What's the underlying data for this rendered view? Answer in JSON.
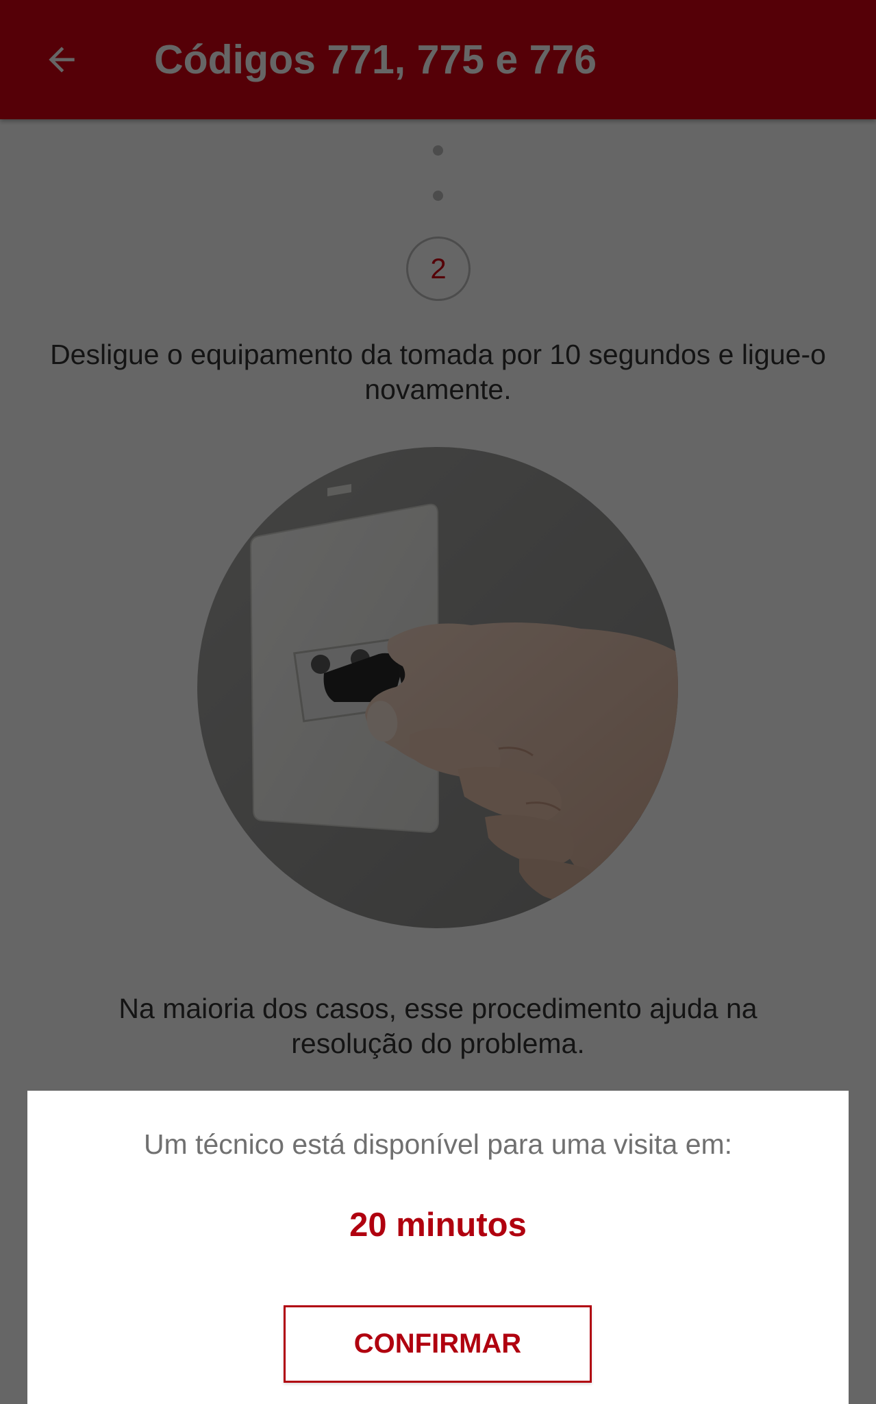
{
  "header": {
    "back_icon": "arrow-left-icon",
    "title": "Códigos 771, 775 e 776"
  },
  "step": {
    "number": "2",
    "instruction": "Desligue o equipamento da tomada por 10 segundos e ligue-o novamente.",
    "image": "hand-unplugging-power-cord-photo",
    "note": "Na maioria dos casos, esse procedimento ajuda na resolução do problema."
  },
  "technician_card": {
    "text": "Um técnico está disponível para uma visita em:",
    "time": "20 minutos",
    "confirm_label": "CONFIRMAR"
  },
  "colors": {
    "brand_red": "#d40012",
    "accent_red": "#b0000f"
  }
}
